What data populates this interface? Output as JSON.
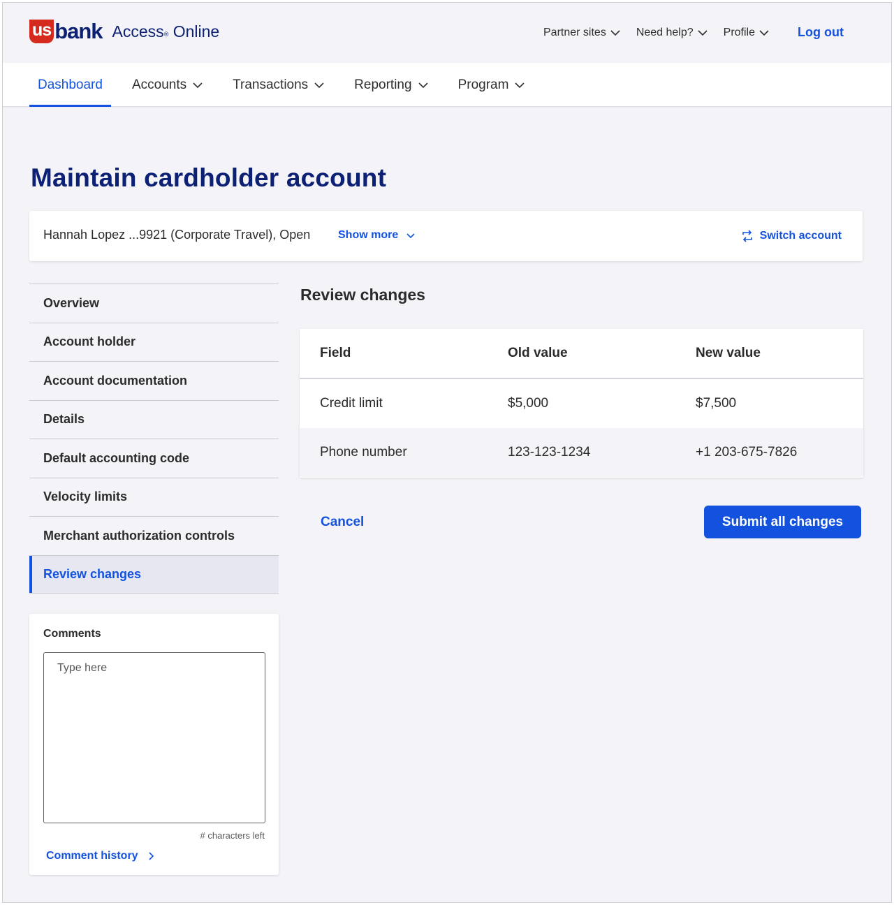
{
  "brand": {
    "logo_us": "us",
    "logo_bank": "bank",
    "product_name": "Access",
    "product_mark": "®",
    "product_suffix": "Online",
    "colors": {
      "brand_red": "#d52b1e",
      "brand_navy": "#0c2074",
      "accent_blue": "#1352de"
    }
  },
  "utility_nav": {
    "items": [
      {
        "label": "Partner sites",
        "icon": "chevron-down-icon"
      },
      {
        "label": "Need help?",
        "icon": "chevron-down-icon"
      },
      {
        "label": "Profile",
        "icon": "chevron-down-icon"
      }
    ],
    "logout_label": "Log out"
  },
  "main_nav": {
    "items": [
      {
        "label": "Dashboard",
        "active": true
      },
      {
        "label": "Accounts",
        "icon": "chevron-down-icon"
      },
      {
        "label": "Transactions",
        "icon": "chevron-down-icon"
      },
      {
        "label": "Reporting",
        "icon": "chevron-down-icon"
      },
      {
        "label": "Program",
        "icon": "chevron-down-icon"
      }
    ]
  },
  "page": {
    "title": "Maintain cardholder account"
  },
  "account_bar": {
    "summary": "Hannah Lopez ...9921 (Corporate Travel), Open",
    "show_more_label": "Show more",
    "switch_account_label": "Switch account",
    "switch_icon": "switch-arrows-icon"
  },
  "side_nav": {
    "items": [
      {
        "label": "Overview"
      },
      {
        "label": "Account holder"
      },
      {
        "label": "Account documentation"
      },
      {
        "label": "Details"
      },
      {
        "label": "Default accounting code"
      },
      {
        "label": "Velocity limits"
      },
      {
        "label": "Merchant authorization controls"
      },
      {
        "label": "Review changes",
        "active": true
      }
    ]
  },
  "comments": {
    "label": "Comments",
    "placeholder": "Type here",
    "value": "",
    "chars_left": "# characters left",
    "history_label": "Comment history"
  },
  "review": {
    "heading": "Review changes",
    "columns": [
      "Field",
      "Old value",
      "New value"
    ],
    "rows": [
      [
        "Credit limit",
        "$5,000",
        "$7,500"
      ],
      [
        "Phone number",
        "123-123-1234",
        "+1 203-675-7826"
      ]
    ],
    "cancel_label": "Cancel",
    "submit_label": "Submit all changes"
  }
}
